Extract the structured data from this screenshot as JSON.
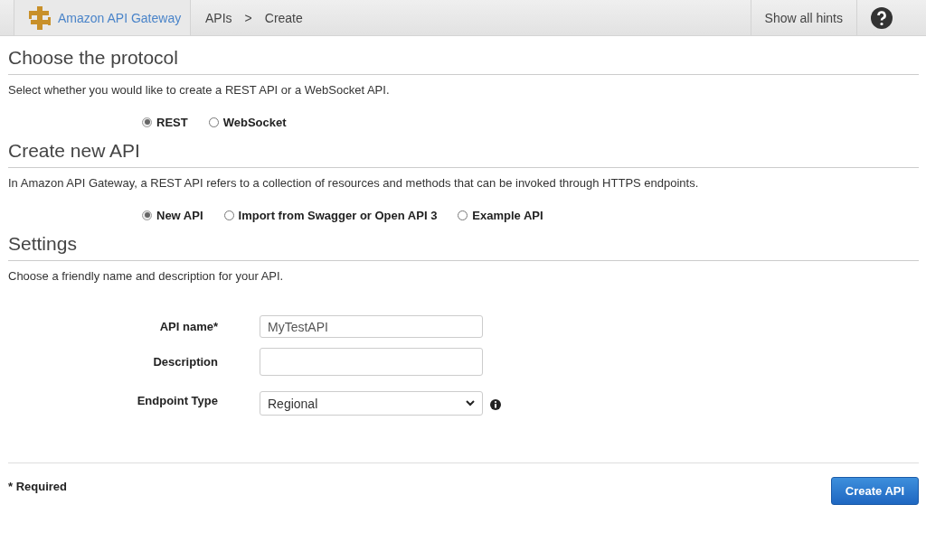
{
  "top_bar": {
    "brand": "Amazon API Gateway",
    "breadcrumb": [
      "APIs",
      ">",
      "Create"
    ],
    "hints_link": "Show all hints"
  },
  "sections": [
    {
      "title": "Choose the protocol",
      "description": "Select whether you would like to create a REST API or a WebSocket API.",
      "options": [
        {
          "label": "REST",
          "selected": true
        },
        {
          "label": "WebSocket",
          "selected": false
        }
      ]
    },
    {
      "title": "Create new API",
      "description": "In Amazon API Gateway, a REST API refers to a collection of resources and methods that can be invoked through HTTPS endpoints.",
      "options": [
        {
          "label": "New API",
          "selected": true
        },
        {
          "label": "Import from Swagger or Open API 3",
          "selected": false
        },
        {
          "label": "Example API",
          "selected": false
        }
      ]
    },
    {
      "title": "Settings",
      "description": "Choose a friendly name and description for your API."
    }
  ],
  "form": [
    {
      "kind": "text",
      "label": "API name*",
      "value": "MyTestAPI"
    },
    {
      "kind": "text",
      "label": "Description"
    },
    {
      "kind": "select",
      "label": "Endpoint Type",
      "value": "Regional",
      "info": true
    }
  ],
  "footer": {
    "note": "* Required",
    "button": "Create API"
  }
}
